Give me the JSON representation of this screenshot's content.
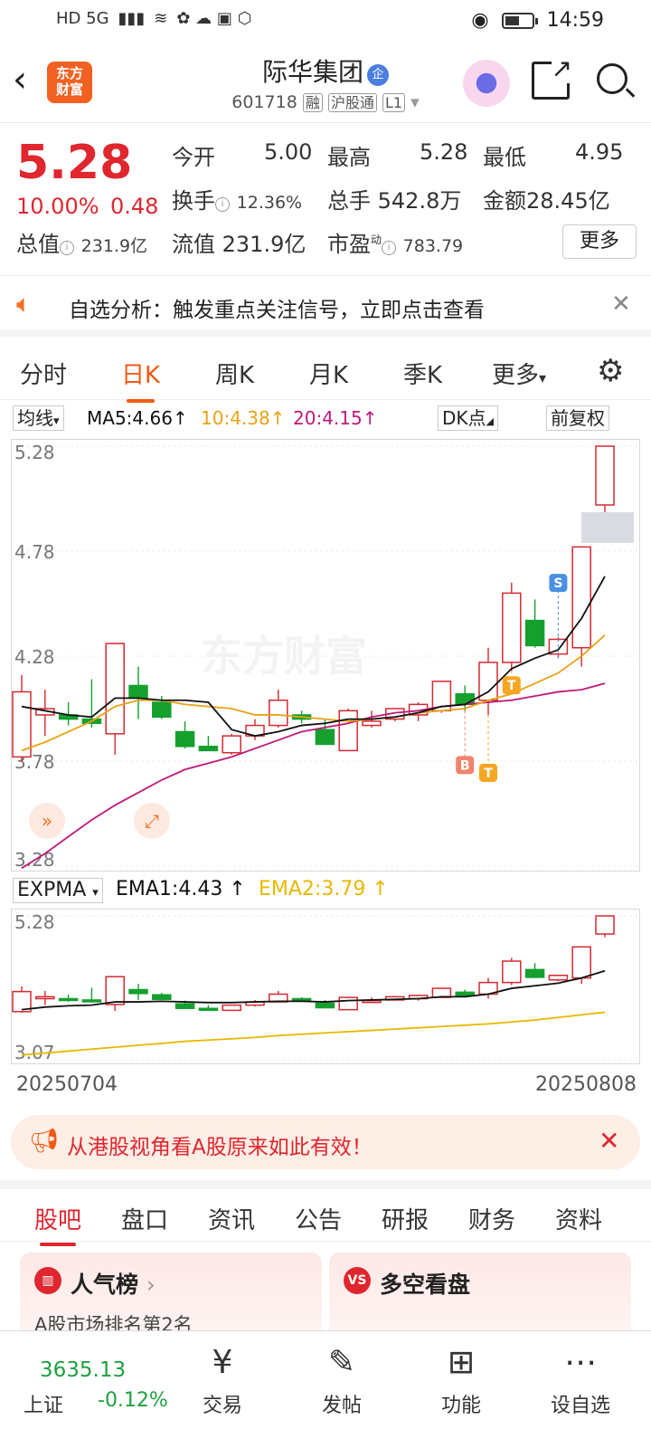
{
  "status_bar": {
    "network": "HD 5G",
    "time": "14:59",
    "battery_level": 0.55
  },
  "header": {
    "logo_text": "东方\n财富",
    "stock_name": "际华集团",
    "name_badge": "企",
    "stock_code": "601718",
    "tag_margin": "融",
    "tag_connect": "沪股通",
    "tag_level": "L1"
  },
  "quote": {
    "price": "5.28",
    "change_pct": "10.00%",
    "change": "0.48",
    "open_label": "今开",
    "open": "5.00",
    "high_label": "最高",
    "high": "5.28",
    "low_label": "最低",
    "low": "4.95",
    "turnover_label": "换手",
    "turnover": "12.36%",
    "volume_label": "总手",
    "volume": "542.8万",
    "amount_label": "金额",
    "amount": "28.45亿",
    "mktcap_label": "总值",
    "mktcap": "231.9亿",
    "float_label": "流值",
    "float": "231.9亿",
    "pe_label": "市盈",
    "pe_sup": "动",
    "pe": "783.79",
    "more_label": "更多"
  },
  "alert": {
    "text": "自选分析：触发重点关注信号，立即点击查看"
  },
  "period_tabs": {
    "items": [
      "分时",
      "日K",
      "周K",
      "月K",
      "季K",
      "更多"
    ],
    "active": "日K"
  },
  "indicators": {
    "ma_select": "均线",
    "ma5": "MA5:4.66",
    "ma10": "10:4.38",
    "ma20": "20:4.15",
    "dk_select": "DK点",
    "adjust_select": "前复权",
    "sub_select": "EXPMA",
    "ema1": "EMA1:4.43",
    "ema2": "EMA2:3.79",
    "colors": {
      "ma5": "#111111",
      "ma10": "#e8a316",
      "ma20": "#c0187a",
      "up": "#d42a30",
      "down": "#15a02e"
    }
  },
  "chart_data": {
    "type": "candlestick",
    "y_ticks": [
      "5.28",
      "4.78",
      "4.28",
      "3.78",
      "3.28"
    ],
    "ylim": [
      3.28,
      5.28
    ],
    "sub_y_ticks": [
      "5.28",
      "3.07"
    ],
    "sub_ylim": [
      3.07,
      5.28
    ],
    "x_start_label": "20250704",
    "x_end_label": "20250808",
    "watermark": "东方财富",
    "signals": [
      {
        "label": "B",
        "index": 19
      },
      {
        "label": "T",
        "index": 20
      },
      {
        "label": "T",
        "index": 21
      },
      {
        "label": "S",
        "index": 23
      }
    ],
    "candles": [
      {
        "o": 3.8,
        "h": 4.19,
        "l": 3.78,
        "c": 4.11
      },
      {
        "o": 4.0,
        "h": 4.12,
        "l": 3.9,
        "c": 4.03
      },
      {
        "o": 4.0,
        "h": 4.06,
        "l": 3.95,
        "c": 3.98
      },
      {
        "o": 3.98,
        "h": 4.17,
        "l": 3.94,
        "c": 3.96
      },
      {
        "o": 3.91,
        "h": 4.34,
        "l": 3.81,
        "c": 4.34
      },
      {
        "o": 4.14,
        "h": 4.23,
        "l": 3.98,
        "c": 4.08
      },
      {
        "o": 4.06,
        "h": 4.09,
        "l": 3.98,
        "c": 3.99
      },
      {
        "o": 3.92,
        "h": 3.97,
        "l": 3.84,
        "c": 3.85
      },
      {
        "o": 3.85,
        "h": 3.9,
        "l": 3.83,
        "c": 3.83
      },
      {
        "o": 3.82,
        "h": 3.91,
        "l": 3.81,
        "c": 3.9
      },
      {
        "o": 3.9,
        "h": 3.98,
        "l": 3.88,
        "c": 3.95
      },
      {
        "o": 3.95,
        "h": 4.12,
        "l": 3.94,
        "c": 4.07
      },
      {
        "o": 4.0,
        "h": 4.02,
        "l": 3.96,
        "c": 3.98
      },
      {
        "o": 3.93,
        "h": 3.98,
        "l": 3.86,
        "c": 3.86
      },
      {
        "o": 3.83,
        "h": 4.03,
        "l": 3.83,
        "c": 4.02
      },
      {
        "o": 3.95,
        "h": 4.02,
        "l": 3.94,
        "c": 3.97
      },
      {
        "o": 3.98,
        "h": 4.03,
        "l": 3.97,
        "c": 4.03
      },
      {
        "o": 4.0,
        "h": 4.06,
        "l": 3.97,
        "c": 4.05
      },
      {
        "o": 4.02,
        "h": 4.16,
        "l": 4.01,
        "c": 4.16
      },
      {
        "o": 4.1,
        "h": 4.14,
        "l": 4.02,
        "c": 4.05
      },
      {
        "o": 4.07,
        "h": 4.32,
        "l": 4.0,
        "c": 4.25
      },
      {
        "o": 4.25,
        "h": 4.63,
        "l": 4.21,
        "c": 4.58
      },
      {
        "o": 4.45,
        "h": 4.55,
        "l": 4.32,
        "c": 4.33
      },
      {
        "o": 4.29,
        "h": 4.37,
        "l": 4.27,
        "c": 4.36
      },
      {
        "o": 4.32,
        "h": 4.8,
        "l": 4.23,
        "c": 4.8
      },
      {
        "o": 5.0,
        "h": 5.28,
        "l": 4.95,
        "c": 5.28
      }
    ],
    "ma5": [
      4.04,
      4.02,
      4.0,
      3.99,
      4.08,
      4.08,
      4.07,
      4.07,
      4.06,
      3.93,
      3.9,
      3.92,
      3.95,
      3.96,
      3.98,
      3.98,
      3.99,
      4.01,
      4.04,
      4.05,
      4.11,
      4.22,
      4.27,
      4.31,
      4.46,
      4.66
    ],
    "ma10": [
      3.83,
      3.87,
      3.92,
      3.97,
      4.04,
      4.07,
      4.07,
      4.05,
      4.04,
      4.03,
      4.0,
      4.0,
      3.99,
      3.98,
      3.97,
      3.98,
      3.99,
      4.01,
      4.02,
      4.03,
      4.07,
      4.1,
      4.15,
      4.2,
      4.28,
      4.38
    ],
    "ma20": [
      3.27,
      3.34,
      3.42,
      3.5,
      3.57,
      3.63,
      3.69,
      3.74,
      3.77,
      3.8,
      3.84,
      3.88,
      3.92,
      3.94,
      3.96,
      3.99,
      4.01,
      4.02,
      4.04,
      4.05,
      4.06,
      4.07,
      4.09,
      4.11,
      4.12,
      4.15
    ],
    "ema1": [
      3.83,
      3.87,
      3.89,
      3.9,
      3.95,
      3.95,
      3.96,
      3.95,
      3.94,
      3.94,
      3.95,
      3.96,
      3.96,
      3.95,
      3.97,
      3.98,
      3.99,
      4.0,
      4.03,
      4.03,
      4.07,
      4.16,
      4.2,
      4.24,
      4.32,
      4.43
    ],
    "ema2": [
      3.13,
      3.16,
      3.19,
      3.22,
      3.25,
      3.28,
      3.31,
      3.34,
      3.36,
      3.38,
      3.4,
      3.43,
      3.45,
      3.47,
      3.49,
      3.51,
      3.53,
      3.55,
      3.57,
      3.59,
      3.61,
      3.64,
      3.67,
      3.71,
      3.75,
      3.79
    ]
  },
  "banner": {
    "text": "从港股视角看A股原来如此有效！"
  },
  "content_tabs": {
    "items": [
      "股吧",
      "盘口",
      "资讯",
      "公告",
      "研报",
      "财务",
      "资料"
    ],
    "active": "股吧"
  },
  "cards": {
    "popularity_title": "人气榜",
    "popularity_sub": "A股市场排名第2名",
    "bullbear_icon": "VS",
    "bullbear_title": "多空看盘"
  },
  "bottom_nav": {
    "index_value": "3635.13",
    "index_name": "上证",
    "index_change": "-0.12%",
    "items": [
      "交易",
      "发帖",
      "功能",
      "设自选"
    ]
  }
}
